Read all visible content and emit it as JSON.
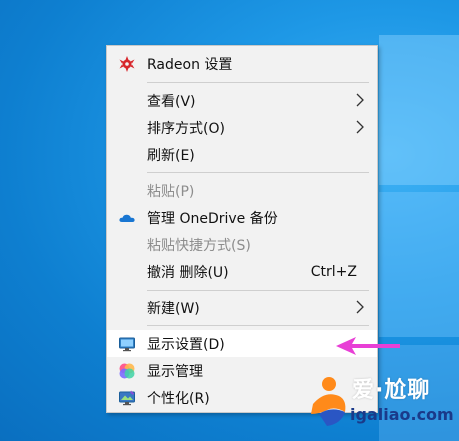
{
  "menu": {
    "items": [
      {
        "label": "Radeon 设置",
        "icon": "radeon-icon"
      },
      {
        "label": "查看(V)",
        "submenu": true
      },
      {
        "label": "排序方式(O)",
        "submenu": true
      },
      {
        "label": "刷新(E)"
      },
      {
        "label": "粘贴(P)",
        "disabled": true
      },
      {
        "label": "管理 OneDrive 备份",
        "icon": "onedrive-cloud-icon"
      },
      {
        "label": "粘贴快捷方式(S)",
        "disabled": true
      },
      {
        "label": "撤消 删除(U)",
        "shortcut": "Ctrl+Z"
      },
      {
        "label": "新建(W)",
        "submenu": true
      },
      {
        "label": "显示设置(D)",
        "icon": "display-settings-icon",
        "highlighted": true
      },
      {
        "label": "显示管理",
        "icon": "display-manager-icon"
      },
      {
        "label": "个性化(R)",
        "icon": "personalize-icon"
      }
    ]
  },
  "watermark": {
    "brand": "爱·尬聊",
    "url": "igaliao.com"
  },
  "colors": {
    "desktop": "#1a8ddb",
    "menu_bg": "#f2f2f2",
    "highlight": "#ffffff",
    "arrow": "#e83fd6",
    "radeon_red": "#d7262b",
    "onedrive_blue": "#1976d2"
  }
}
